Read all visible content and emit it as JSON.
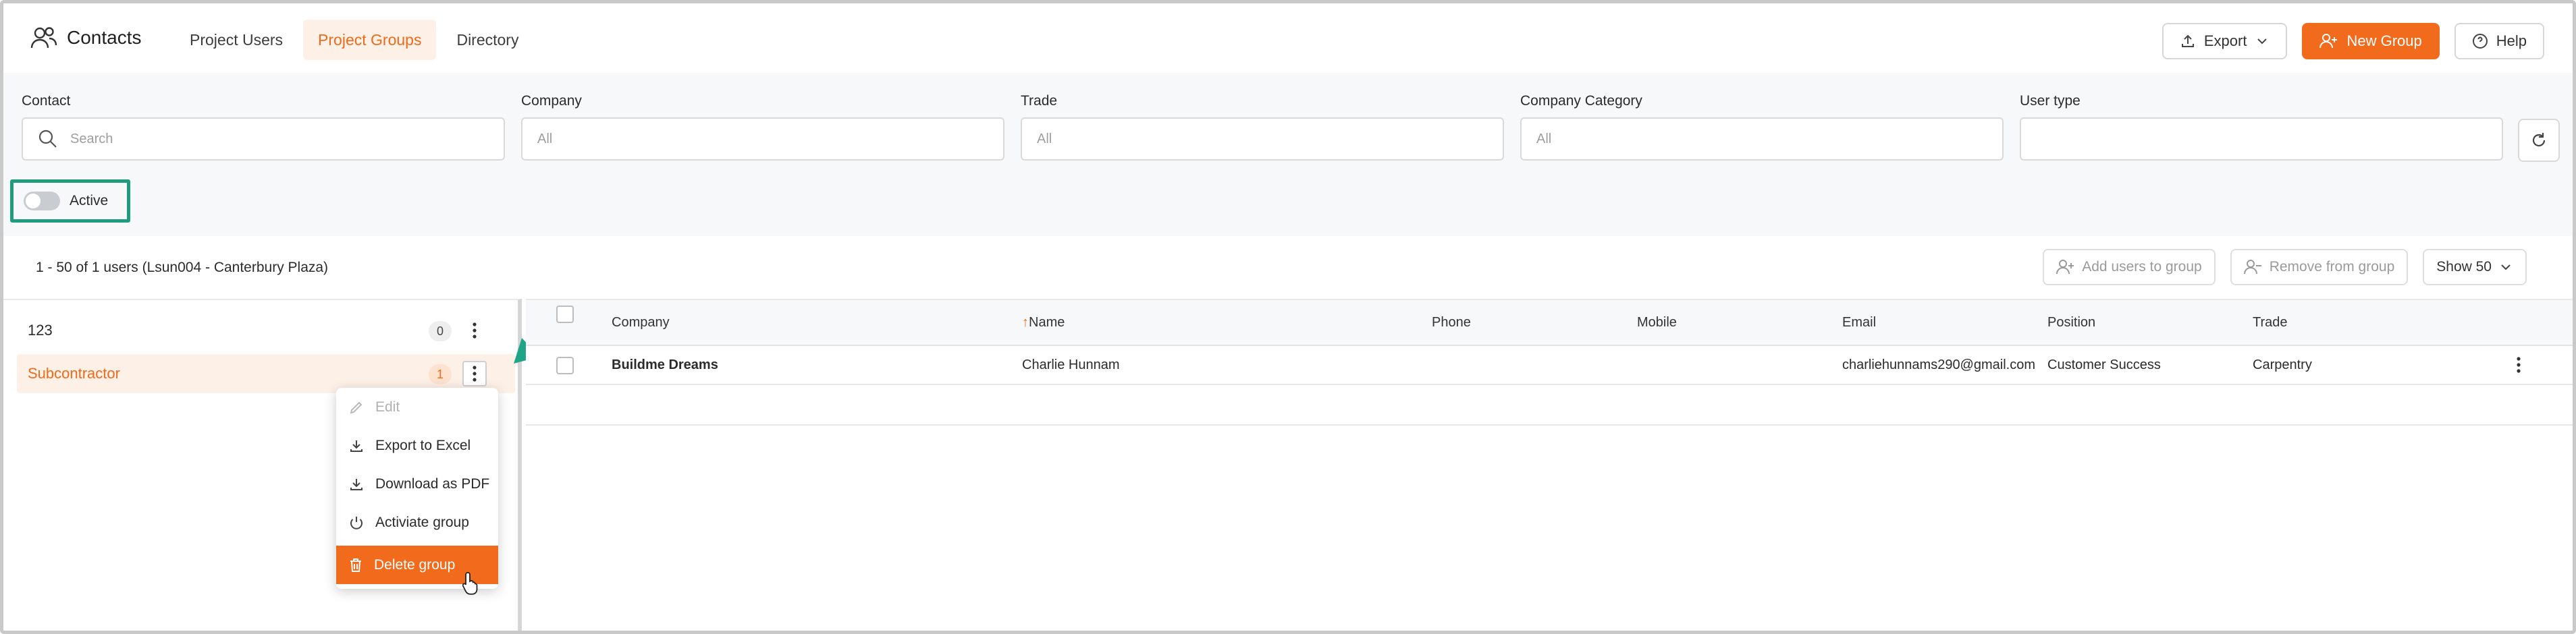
{
  "header": {
    "title": "Contacts",
    "tabs": [
      {
        "label": "Project Users",
        "active": false
      },
      {
        "label": "Project Groups",
        "active": true
      },
      {
        "label": "Directory",
        "active": false
      }
    ],
    "export_label": "Export",
    "new_group_label": "New Group",
    "help_label": "Help"
  },
  "filters": {
    "contact": {
      "label": "Contact",
      "placeholder": "Search"
    },
    "company": {
      "label": "Company",
      "value": "All"
    },
    "trade": {
      "label": "Trade",
      "value": "All"
    },
    "company_category": {
      "label": "Company Category",
      "value": "All"
    },
    "user_type": {
      "label": "User type",
      "value": ""
    },
    "active_toggle": {
      "label": "Active",
      "on": false
    }
  },
  "toolbar": {
    "summary": "1 - 50 of 1 users (Lsun004 - Canterbury Plaza)",
    "add_users_label": "Add users to group",
    "remove_label": "Remove from group",
    "show_label": "Show 50"
  },
  "groups": [
    {
      "name": "123",
      "count": "0",
      "selected": false
    },
    {
      "name": "Subcontractor",
      "count": "1",
      "selected": true
    }
  ],
  "context_menu": [
    {
      "label": "Edit",
      "icon": "pencil-icon",
      "disabled": true
    },
    {
      "label": "Export to Excel",
      "icon": "download-icon"
    },
    {
      "label": "Download as PDF",
      "icon": "download-icon"
    },
    {
      "label": "Activiate group",
      "icon": "power-icon"
    },
    {
      "label": "Delete group",
      "icon": "trash-icon",
      "highlighted": true
    }
  ],
  "table": {
    "columns": [
      "Company",
      "Name",
      "Phone",
      "Mobile",
      "Email",
      "Position",
      "Trade"
    ],
    "sort_indicator": "↑",
    "rows": [
      {
        "company": "Buildme Dreams",
        "name": "Charlie Hunnam",
        "phone": "",
        "mobile": "",
        "email": "charliehunnams290@gmail.com",
        "position": "Customer Success",
        "trade": "Carpentry"
      }
    ]
  },
  "colors": {
    "accent": "#f26a1b",
    "accent_light": "#fdf0e6",
    "highlight_box": "#1e9c7d",
    "annotation_arrow": "#1ea487"
  }
}
